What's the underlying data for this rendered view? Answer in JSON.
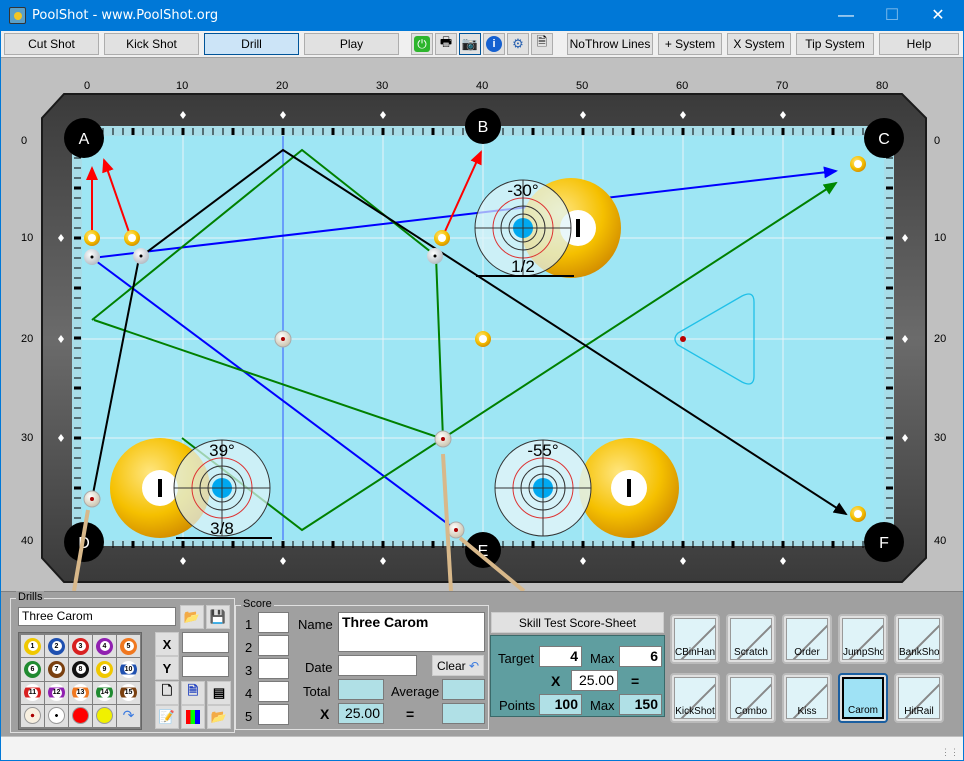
{
  "window": {
    "title": "PoolShot - www.PoolShot.org",
    "controls": [
      "minimize",
      "maximize",
      "close"
    ]
  },
  "toolbar": {
    "modes": [
      {
        "label": "Cut Shot",
        "active": false
      },
      {
        "label": "Kick Shot",
        "active": false
      },
      {
        "label": "Drill",
        "active": true
      },
      {
        "label": "Play",
        "active": false
      }
    ],
    "icons": [
      "power-icon",
      "printer-icon",
      "camera-icon",
      "info-icon",
      "gear-icon",
      "help-document-icon"
    ],
    "options": [
      "NoThrow Lines",
      "+ System",
      "X System",
      "Tip System",
      "Help"
    ]
  },
  "table": {
    "x_axis_labels": [
      "0",
      "10",
      "20",
      "30",
      "40",
      "50",
      "60",
      "70",
      "80"
    ],
    "y_axis_labels": [
      "0",
      "10",
      "20",
      "30",
      "40"
    ],
    "pockets": [
      "A",
      "B",
      "C",
      "D",
      "E",
      "F"
    ],
    "colors": {
      "cloth": "#9ee6f4",
      "rail": "#5a5a5a",
      "blue_line": "#0000ff",
      "green_line": "#008000",
      "black_line": "#000000",
      "red_line": "#ff0000",
      "rack": "#20c0e8"
    },
    "aim_guides": [
      {
        "angle": "-30°",
        "fraction": "1/2"
      },
      {
        "angle": "39°",
        "fraction": "3/8"
      },
      {
        "angle": "-55°",
        "fraction": ""
      }
    ]
  },
  "drills": {
    "group_label": "Drills",
    "name_value": "Three Carom",
    "x_label": "X",
    "y_label": "Y",
    "x_value": "",
    "y_value": "",
    "balls": [
      "1",
      "2",
      "3",
      "4",
      "5",
      "6",
      "7",
      "8",
      "9",
      "10",
      "11",
      "12",
      "13",
      "14",
      "15"
    ],
    "extra": [
      "cue-ball-red-dot",
      "cue-ball-black-dot",
      "red-marker",
      "yellow-marker",
      "redo"
    ]
  },
  "score": {
    "group_label": "Score",
    "rows": [
      "1",
      "2",
      "3",
      "4",
      "5"
    ],
    "name_label": "Name",
    "name_value": "Three Carom",
    "date_label": "Date",
    "date_value": "",
    "clear_label": "Clear",
    "total_label": "Total",
    "total_value": "",
    "average_label": "Average",
    "average_value": "",
    "x_label": "X",
    "multiplier": "25.00",
    "equals": "=",
    "result_value": ""
  },
  "skill_test": {
    "header": "Skill Test Score-Sheet",
    "target_label": "Target",
    "target_value": "4",
    "max_label": "Max",
    "max_value": "6",
    "x_label": "X",
    "multiplier": "25.00",
    "equals": "=",
    "points_label": "Points",
    "points_value": "100",
    "points_max_label": "Max",
    "points_max_value": "150"
  },
  "shot_types": [
    {
      "label": "CBinHand",
      "selected": false
    },
    {
      "label": "Scratch",
      "selected": false
    },
    {
      "label": "Order",
      "selected": false
    },
    {
      "label": "JumpShot",
      "selected": false
    },
    {
      "label": "BankShot",
      "selected": false
    },
    {
      "label": "KickShot",
      "selected": false
    },
    {
      "label": "Combo",
      "selected": false
    },
    {
      "label": "Kiss",
      "selected": false
    },
    {
      "label": "Carom",
      "selected": true
    },
    {
      "label": "HitRail",
      "selected": false
    }
  ]
}
